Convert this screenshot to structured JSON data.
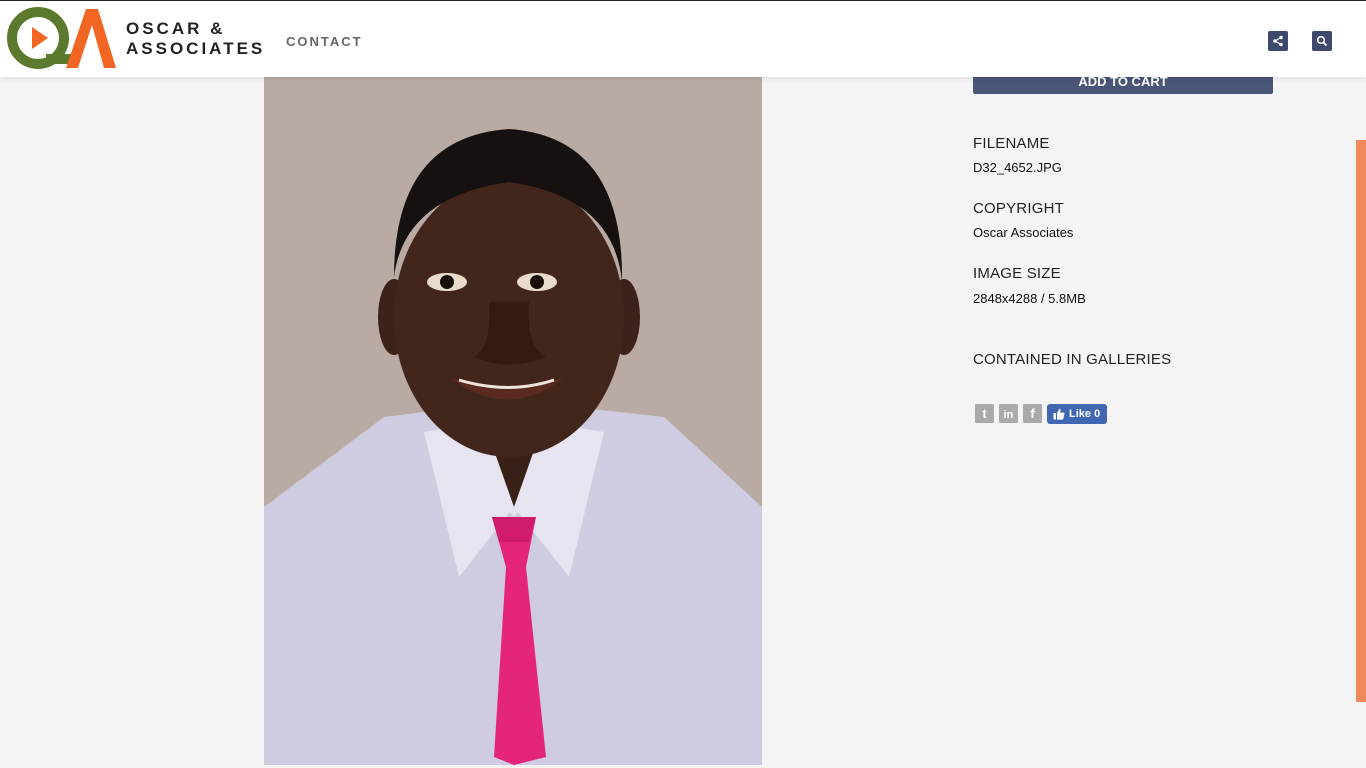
{
  "header": {
    "brand_line1": "OSCAR &",
    "brand_line2": "ASSOCIATES",
    "nav_contact": "CONTACT",
    "share_icon": "share-icon",
    "search_icon": "search-icon"
  },
  "colors": {
    "brand_green": "#5b7a2e",
    "brand_orange": "#f26522",
    "button_navy": "#4a5677",
    "accent_bar": "#ee8a5c"
  },
  "photo": {
    "subject": "portrait-photo"
  },
  "sidebar": {
    "add_to_cart": "ADD TO CART",
    "filename_label": "FILENAME",
    "filename_value": "D32_4652.JPG",
    "copyright_label": "COPYRIGHT",
    "copyright_value": "Oscar Associates",
    "image_size_label": "IMAGE SIZE",
    "image_size_value": "2848x4288 / 5.8MB",
    "galleries_label": "CONTAINED IN GALLERIES"
  },
  "social": {
    "twitter": "t",
    "linkedin": "in",
    "facebook": "f",
    "like_label": "Like 0"
  }
}
